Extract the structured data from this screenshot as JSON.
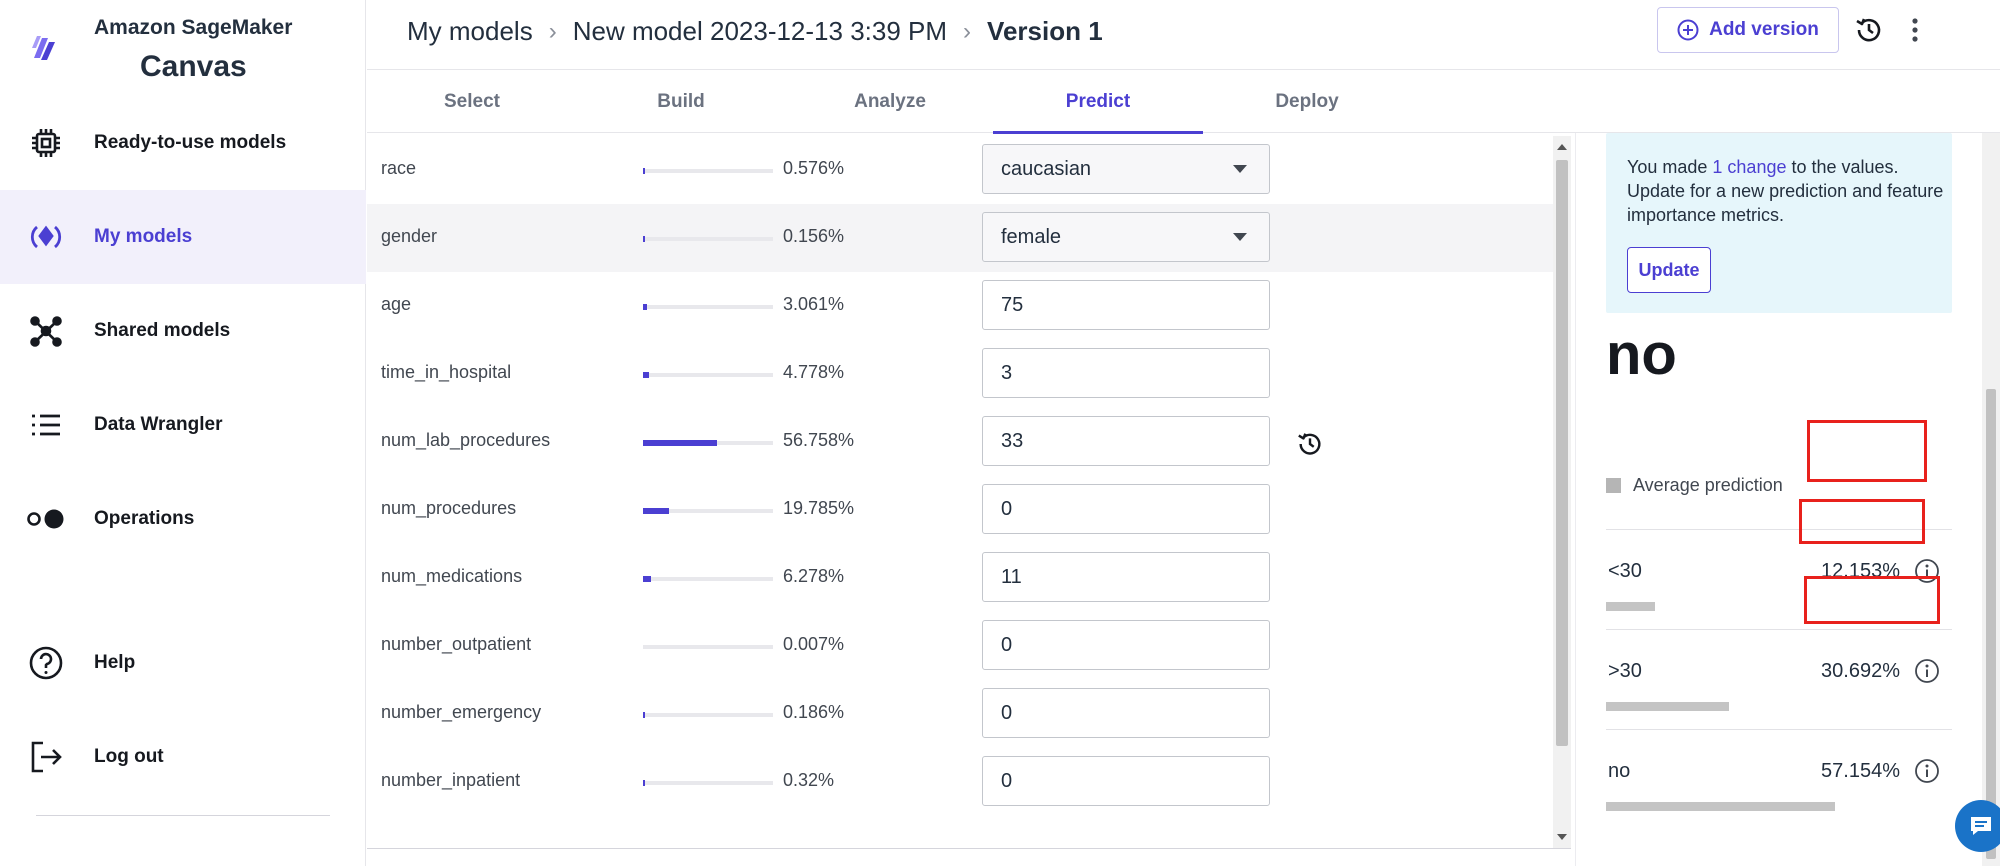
{
  "brand": {
    "line1": "Amazon SageMaker",
    "line2": "Canvas"
  },
  "sidebar": {
    "items": [
      {
        "label": "Ready-to-use models",
        "icon": "chip-icon"
      },
      {
        "label": "My models",
        "icon": "my-models-icon",
        "active": true
      },
      {
        "label": "Shared models",
        "icon": "network-icon"
      },
      {
        "label": "Data Wrangler",
        "icon": "list-icon"
      },
      {
        "label": "Operations",
        "icon": "toggle-icon"
      },
      {
        "label": "Help",
        "icon": "help-icon"
      },
      {
        "label": "Log out",
        "icon": "logout-icon"
      }
    ]
  },
  "header": {
    "crumb1": "My models",
    "crumb2": "New model 2023-12-13 3:39 PM",
    "crumb3": "Version 1",
    "add_version": "Add version"
  },
  "tabs": [
    "Select",
    "Build",
    "Analyze",
    "Predict",
    "Deploy"
  ],
  "active_tab": "Predict",
  "features": [
    {
      "name": "race",
      "pct": "0.576%",
      "importance": 0.576,
      "value": "caucasian",
      "type": "select"
    },
    {
      "name": "gender",
      "pct": "0.156%",
      "importance": 0.156,
      "value": "female",
      "type": "select"
    },
    {
      "name": "age",
      "pct": "3.061%",
      "importance": 3.061,
      "value": "75",
      "type": "input"
    },
    {
      "name": "time_in_hospital",
      "pct": "4.778%",
      "importance": 4.778,
      "value": "3",
      "type": "input"
    },
    {
      "name": "num_lab_procedures",
      "pct": "56.758%",
      "importance": 56.758,
      "value": "33",
      "type": "input",
      "changed": true
    },
    {
      "name": "num_procedures",
      "pct": "19.785%",
      "importance": 19.785,
      "value": "0",
      "type": "input"
    },
    {
      "name": "num_medications",
      "pct": "6.278%",
      "importance": 6.278,
      "value": "11",
      "type": "input"
    },
    {
      "name": "number_outpatient",
      "pct": "0.007%",
      "importance": 0.007,
      "value": "0",
      "type": "input"
    },
    {
      "name": "number_emergency",
      "pct": "0.186%",
      "importance": 0.186,
      "value": "0",
      "type": "input"
    },
    {
      "name": "number_inpatient",
      "pct": "0.32%",
      "importance": 0.32,
      "value": "0",
      "type": "input"
    }
  ],
  "panel": {
    "notice_before": "You made ",
    "notice_link": "1 change",
    "notice_after": " to the values. Update for a new prediction and feature importance metrics.",
    "update_button": "Update",
    "prediction": "no",
    "avg_legend": "Average prediction",
    "predictions": [
      {
        "label": "<30",
        "pct": "12.153%",
        "value": 12.153
      },
      {
        "label": ">30",
        "pct": "30.692%",
        "value": 30.692
      },
      {
        "label": "no",
        "pct": "57.154%",
        "value": 57.154
      }
    ]
  },
  "colors": {
    "accent": "#4b3fd2",
    "highlight": "#e8211c",
    "notice_bg": "#e6f6fb"
  }
}
